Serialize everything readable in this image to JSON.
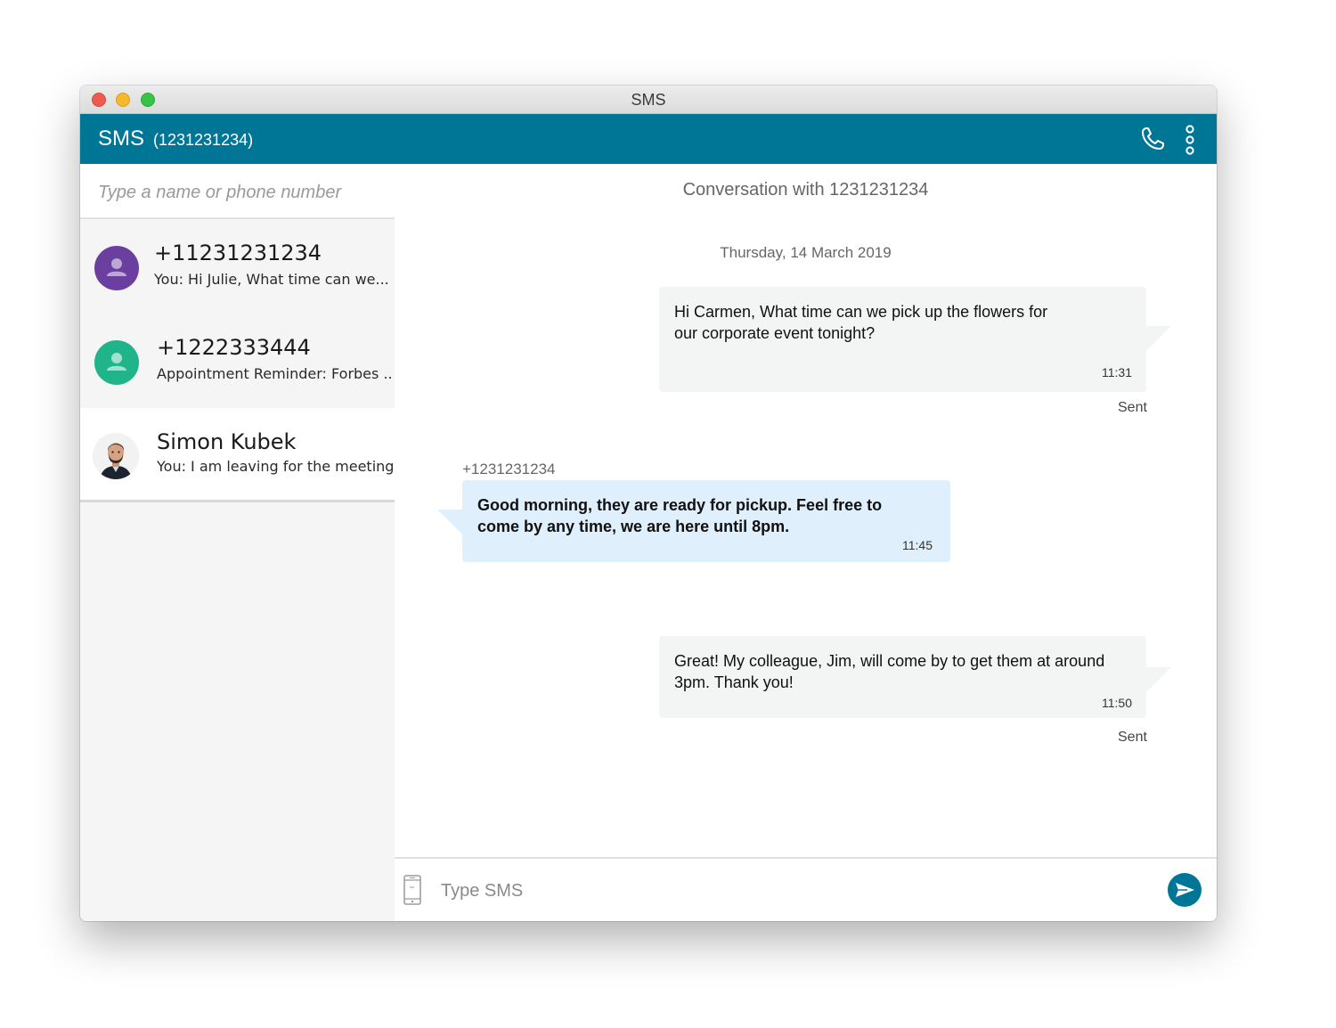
{
  "window": {
    "title": "SMS"
  },
  "appbar": {
    "title": "SMS",
    "number": "(1231231234)",
    "icons": {
      "call": "phone-icon",
      "menu": "more-vertical-icon"
    },
    "color": "#007697"
  },
  "sidebar": {
    "search_placeholder": "Type a name or phone number",
    "contacts": [
      {
        "name": "+11231231234",
        "preview": "You: Hi Julie, What time can we...",
        "avatar_color": "#6b3fa0",
        "avatar": "person-icon"
      },
      {
        "name": "+1222333444",
        "preview": "Appointment Reminder: Forbes ...",
        "avatar_color": "#1fb48a",
        "avatar": "person-icon"
      },
      {
        "name": "Simon Kubek",
        "preview": "You: I am leaving for the meeting...",
        "avatar": "profile-photo",
        "selected": true
      }
    ]
  },
  "conversation": {
    "header": "Conversation with 1231231234",
    "date": "Thursday, 14 March 2019",
    "messages": [
      {
        "direction": "out",
        "text_line1": "Hi Carmen, What time can we pick up the flowers for",
        "text_line2": "our corporate event tonight?",
        "time": "11:31",
        "status": "Sent"
      },
      {
        "direction": "in",
        "sender": "+1231231234",
        "text_line1": "Good morning, they are ready for pickup. Feel free to",
        "text_line2": "come by any time, we are here until 8pm.",
        "time": "11:45"
      },
      {
        "direction": "out",
        "text_line1": "Great! My colleague, Jim, will come by to get them at around",
        "text_line2": "3pm. Thank you!",
        "time": "11:50",
        "status": "Sent"
      }
    ]
  },
  "composer": {
    "placeholder": "Type SMS",
    "icons": {
      "device": "mobile-device-icon",
      "send": "send-icon"
    },
    "send_color": "#007697"
  }
}
